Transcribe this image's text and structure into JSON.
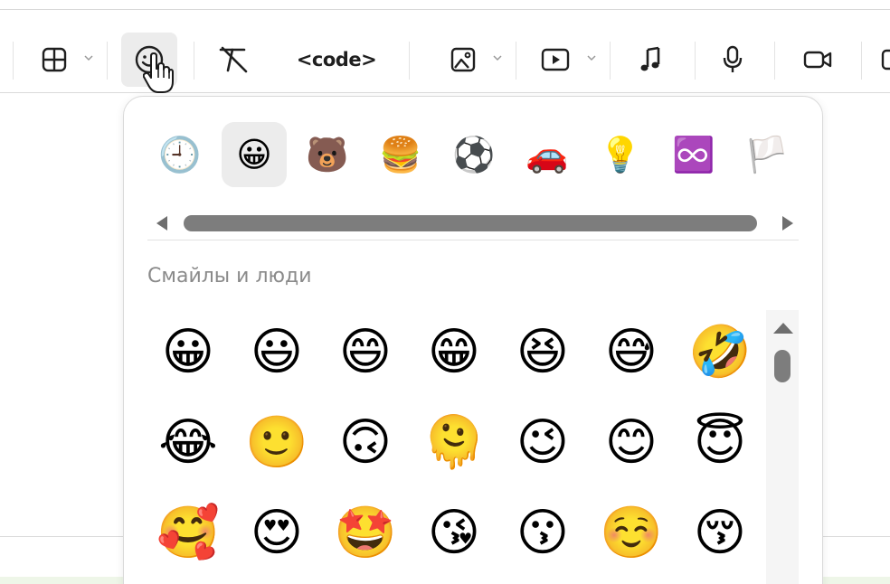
{
  "toolbar": {
    "items": [
      {
        "name": "table-button",
        "icon": "table-icon",
        "has_dropdown": true
      },
      {
        "name": "emoji-button",
        "icon": "emoji-icon",
        "active": true
      },
      {
        "name": "clear-format-button",
        "icon": "clear-format-icon"
      },
      {
        "name": "code-button",
        "label": "<code>"
      },
      {
        "name": "image-button",
        "icon": "image-icon",
        "has_dropdown": true
      },
      {
        "name": "video-button",
        "icon": "video-play-icon",
        "has_dropdown": true
      },
      {
        "name": "audio-button",
        "icon": "music-note-icon"
      },
      {
        "name": "microphone-button",
        "icon": "microphone-icon"
      },
      {
        "name": "camera-button",
        "icon": "camera-icon"
      }
    ],
    "code_label": "<code>"
  },
  "emoji_picker": {
    "categories": [
      {
        "name": "recent",
        "glyph": "🕘"
      },
      {
        "name": "smileys-people",
        "glyph": "😀",
        "active": true
      },
      {
        "name": "animals-nature",
        "glyph": "🐻"
      },
      {
        "name": "food-drink",
        "glyph": "🍔"
      },
      {
        "name": "activity",
        "glyph": "⚽"
      },
      {
        "name": "travel-places",
        "glyph": "🚗"
      },
      {
        "name": "objects",
        "glyph": "💡"
      },
      {
        "name": "symbols",
        "glyph": "♾️"
      },
      {
        "name": "flags",
        "glyph": "🏳️"
      }
    ],
    "section_title": "Смайлы и люди",
    "emojis": [
      [
        "😀",
        "😃",
        "😄",
        "😁",
        "😆",
        "😅",
        "🤣"
      ],
      [
        "😂",
        "🙂",
        "🙃",
        "🫠",
        "😉",
        "😊",
        "😇"
      ],
      [
        "🥰",
        "😍",
        "🤩",
        "😘",
        "😗",
        "☺️",
        "😚"
      ]
    ]
  },
  "colors": {
    "accent_active_bg": "#ececec",
    "scrollbar": "#7d7d7d",
    "section_title": "#8a8a8a"
  }
}
